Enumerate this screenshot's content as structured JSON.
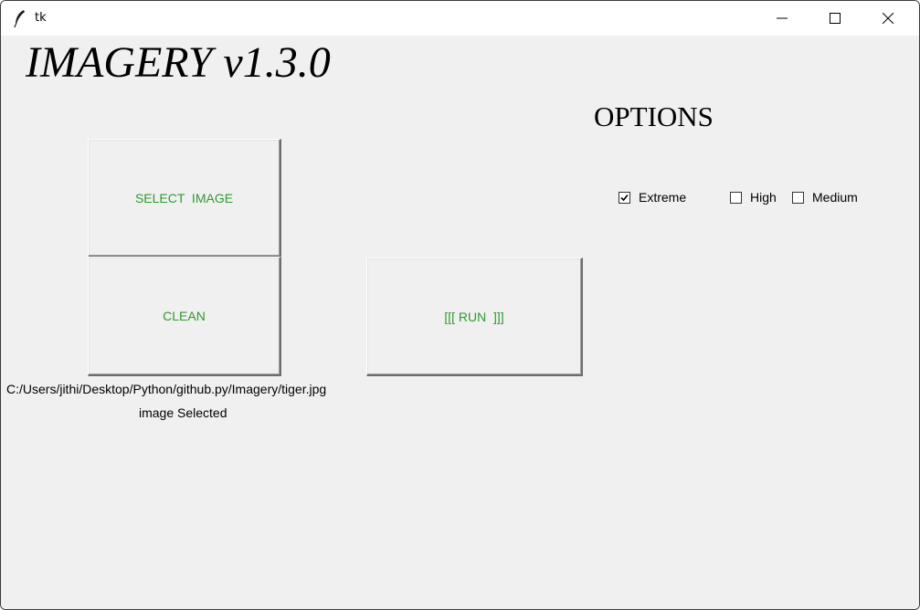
{
  "window": {
    "title": "tk",
    "controls": [
      "minimize",
      "maximize",
      "close"
    ]
  },
  "app": {
    "title": "IMAGERY v1.3.0",
    "options_heading": "OPTIONS"
  },
  "buttons": {
    "select_image": "SELECT  IMAGE",
    "clean": "CLEAN",
    "run": "[[[ RUN  ]]]"
  },
  "options": [
    {
      "label": "Extreme",
      "checked": true
    },
    {
      "label": "High",
      "checked": false
    },
    {
      "label": "Medium",
      "checked": false
    }
  ],
  "status": {
    "file_path": "C:/Users/jithi/Desktop/Python/github.py/Imagery/tiger.jpg",
    "message": "image Selected"
  },
  "colors": {
    "button_text": "#2e9a2e",
    "background": "#f0f0f0"
  },
  "icons": {
    "app_icon": "feather-icon",
    "minimize": "minimize-icon",
    "maximize": "maximize-icon",
    "close": "close-icon"
  }
}
